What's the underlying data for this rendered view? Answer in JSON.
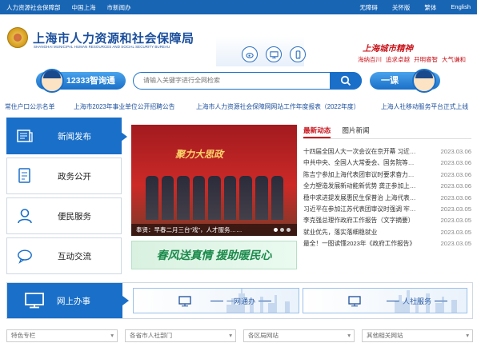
{
  "topbar": {
    "left_links": [
      "人力资源社会保障部",
      "中国上海",
      "市新闻办"
    ],
    "right_links": [
      "无障碍",
      "关怀版",
      "繁体",
      "English"
    ]
  },
  "header": {
    "title": "上海市人力资源和社会保障局",
    "subtitle": "SHANGHAI MUNICIPAL HUMAN RESOURCES AND SOCIAL SECURITY BUREAU",
    "icons": [
      "weibo-icon",
      "desktop-icon",
      "mobile-icon"
    ],
    "spirit_title": "上海城市精神",
    "spirit_items": [
      "海纳百川",
      "追求卓越",
      "开明睿智",
      "大气谦和"
    ],
    "colors": {
      "brand": "#1a6fc8",
      "topbar": "#1865b4",
      "accent_red": "#c8161d"
    }
  },
  "search": {
    "hotline_label": "12333智询通",
    "placeholder": "请输入关键字进行全网检索",
    "yike_label": "一课"
  },
  "ticker": [
    "常住户口公示名单",
    "上海市2023年事业单位公开招聘公告",
    "上海市人力资源社会保障网网站工作年度报表（2022年度）",
    "上海人社移动服务平台正式上线"
  ],
  "leftnav": [
    {
      "label": "新闻发布",
      "icon": "newspaper-icon",
      "active": true
    },
    {
      "label": "政务公开",
      "icon": "document-icon",
      "active": false
    },
    {
      "label": "便民服务",
      "icon": "user-icon",
      "active": false
    },
    {
      "label": "互动交流",
      "icon": "chat-icon",
      "active": false
    }
  ],
  "carousel": {
    "caption": "奉贤：早春二月三台“戏”，人才服务……",
    "banner_text": "聚力大思政"
  },
  "spring_banner": "春风送真情 援助暖民心",
  "news": {
    "tabs": [
      "最新动态",
      "图片新闻"
    ],
    "items": [
      {
        "title": "十四届全国人大一次会议在京开幕 习近…",
        "date": "2023.03.06"
      },
      {
        "title": "中共中央、全国人大常委会、国务院等…",
        "date": "2023.03.06"
      },
      {
        "title": "陈吉宁参加上海代表团审议时要求奋力…",
        "date": "2023.03.06"
      },
      {
        "title": "全力塑造发展新动能新优势 龚正参加上…",
        "date": "2023.03.06"
      },
      {
        "title": "稳中求进提发展惠民生保普治 上海代表…",
        "date": "2023.03.06"
      },
      {
        "title": "习近平在参加江苏代表团审议时强调 牢…",
        "date": "2023.03.05"
      },
      {
        "title": "李克强总理作政府工作报告（文字摘要）",
        "date": "2023.03.05"
      },
      {
        "title": "就业优先，落实落细稳就业",
        "date": "2023.03.05"
      },
      {
        "title": "最全！一图读懂2023年《政府工作报告》",
        "date": "2023.03.05"
      }
    ]
  },
  "online": {
    "label": "网上办事",
    "services": [
      "一网通办",
      "人社服务"
    ]
  },
  "selects": [
    "特色专栏",
    "各省市人社部门",
    "各区局网站",
    "其他相关网站"
  ]
}
